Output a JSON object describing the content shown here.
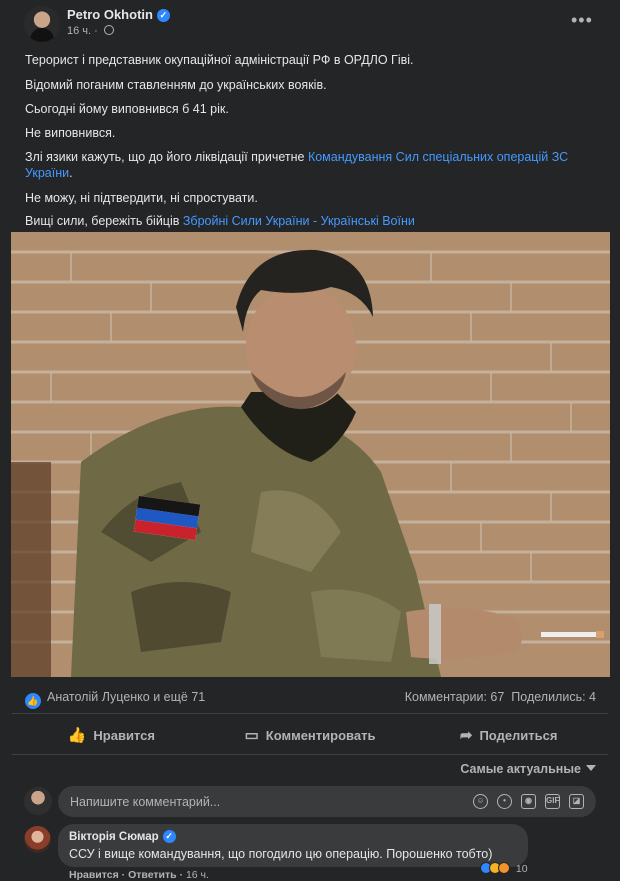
{
  "post": {
    "author": "Petro Okhotin",
    "time": "16 ч.",
    "more": "•••",
    "lines": [
      "Терорист і представник окупаційної адміністрації РФ в ОРДЛО Гіві.",
      "Відомий поганим ставленням до українських вояків.",
      "Сьогодні йому виповнився б 41 рік.",
      "Не виповнився."
    ],
    "line5_text": "Злі язики кажуть, що до його ліквідації причетне ",
    "line5_link1": "Командування Сил спеціальних операцій ЗС",
    "line5_link2": "України",
    "line5_end": ".",
    "line6": "Не можу, ні підтвердити, ні спростувати.",
    "line7_text": "Вищі сили, бережіть бійців ",
    "line7_link": "Збройні Сили України - Українські Воїни"
  },
  "stats": {
    "reactions_text": "Анатолій Луценко и ещё 71",
    "comments": "Комментарии: 67",
    "shares": "Поделились: 4"
  },
  "actions": {
    "like": "Нравится",
    "comment": "Комментировать",
    "share": "Поделиться"
  },
  "sort_label": "Самые актуальные",
  "comment_input": {
    "placeholder": "Напишите комментарий..."
  },
  "comment": {
    "author": "Вікторія Сюмар",
    "text": "ССУ і вище командування, що погодило цю операцію. Порошенко тобто)",
    "reaction_count": "10",
    "like": "Нравится",
    "reply": "Ответить",
    "time": "16 ч."
  },
  "colors": {
    "card_bg": "#242526",
    "link": "#4599ff",
    "accent": "#2d88ff",
    "muted": "#b0b3b8"
  }
}
